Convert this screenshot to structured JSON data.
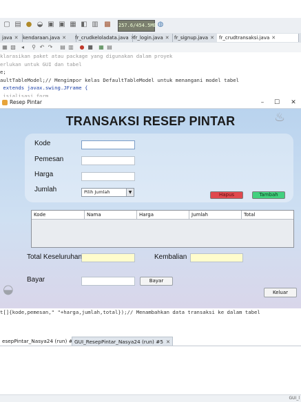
{
  "ide": {
    "memory": "257.6/454.5MB",
    "tabs": [
      {
        "label": "java",
        "active": false
      },
      {
        "label": "kendaraan.java",
        "active": false
      },
      {
        "label": "fr_crudkeloladata.java",
        "active": false
      },
      {
        "label": "fr_login.java",
        "active": false
      },
      {
        "label": "fr_signup.java",
        "active": false
      },
      {
        "label": "fr_crudtransaksi.java",
        "active": true
      }
    ],
    "code_lines": [
      "klarasikan paket atau package yang digunakan dalam proyek",
      "erlukan untuk GUI dan tabel",
      "e;",
      "aultTableModel;// Mengimpor kelas DefaultTableModel untuk menangani model tabel",
      " extends javax.swing.JFrame {",
      " isialisasi form"
    ],
    "output_line": "t[]{kode,pemesan,\" \"+harga,jumlah,total});// Menambahkan data transaksi ke dalam tabel",
    "output_tabs": [
      {
        "label": "esepPintar_Nasya24 (run) #4",
        "active": false
      },
      {
        "label": "GUI_ResepPintar_Nasya24 (run) #5",
        "active": true
      }
    ],
    "status_right": "GUI_l"
  },
  "window": {
    "title": "Resep Pintar",
    "controls": {
      "minimize": "–",
      "maximize": "☐",
      "close": "✕"
    }
  },
  "form": {
    "heading": "TRANSAKSI RESEP PINTAR",
    "labels": {
      "kode": "Kode",
      "pemesan": "Pemesan",
      "harga": "Harga",
      "jumlah": "Jumlah",
      "total_keseluruhan": "Total Keseluruhan",
      "kembalian": "Kembalian",
      "bayar": "Bayar"
    },
    "values": {
      "kode": "",
      "pemesan": "",
      "harga": "",
      "total_keseluruhan": "",
      "kembalian": "",
      "bayar": ""
    },
    "jumlah_selected": "Pilih Jumlah",
    "buttons": {
      "hapus": "Hapus",
      "tambah": "Tambah",
      "bayar": "Bayar",
      "keluar": "Keluar"
    },
    "table_columns": [
      "Kode",
      "Nama",
      "Harga",
      "Jumlah",
      "Total"
    ]
  },
  "colors": {
    "hapus": "#e0494e",
    "tambah": "#42d07e",
    "yellow_field": "#fffccc"
  }
}
